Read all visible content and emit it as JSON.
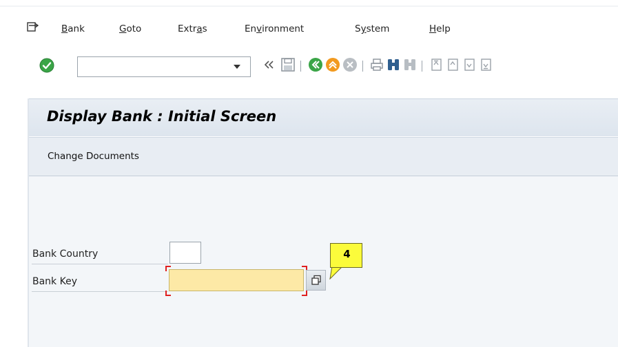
{
  "menu": {
    "items": [
      {
        "id": "bank",
        "pre": "",
        "u": "B",
        "post": "ank"
      },
      {
        "id": "goto",
        "pre": "",
        "u": "G",
        "post": "oto"
      },
      {
        "id": "extras",
        "pre": "Extr",
        "u": "a",
        "post": "s"
      },
      {
        "id": "environment",
        "pre": "En",
        "u": "v",
        "post": "ironment"
      },
      {
        "id": "system",
        "pre": "S",
        "u": "y",
        "post": "stem"
      },
      {
        "id": "help",
        "pre": "",
        "u": "H",
        "post": "elp"
      }
    ]
  },
  "toolbar": {
    "command_field_value": "",
    "icons": [
      "ok-checkmark-icon",
      "chevron-double-left-icon",
      "save-icon",
      "back-icon",
      "exit-icon",
      "cancel-icon",
      "print-icon",
      "find-icon",
      "find-next-icon",
      "first-page-icon",
      "previous-page-icon",
      "next-page-icon",
      "last-page-icon"
    ]
  },
  "screen": {
    "title": "Display Bank : Initial Screen",
    "app_toolbar": {
      "change_documents_label": "Change Documents"
    }
  },
  "form": {
    "bank_country_label": "Bank Country",
    "bank_country_value": "",
    "bank_key_label": "Bank Key",
    "bank_key_value": ""
  },
  "annotation": {
    "callout_number": "4"
  },
  "colors": {
    "ok_green": "#3aa547",
    "required_field_yellow": "#fde9a6",
    "callout_yellow": "#fbfb3b",
    "focus_corner_red": "#e02020",
    "title_bar_blue": "#e3e9f1"
  }
}
